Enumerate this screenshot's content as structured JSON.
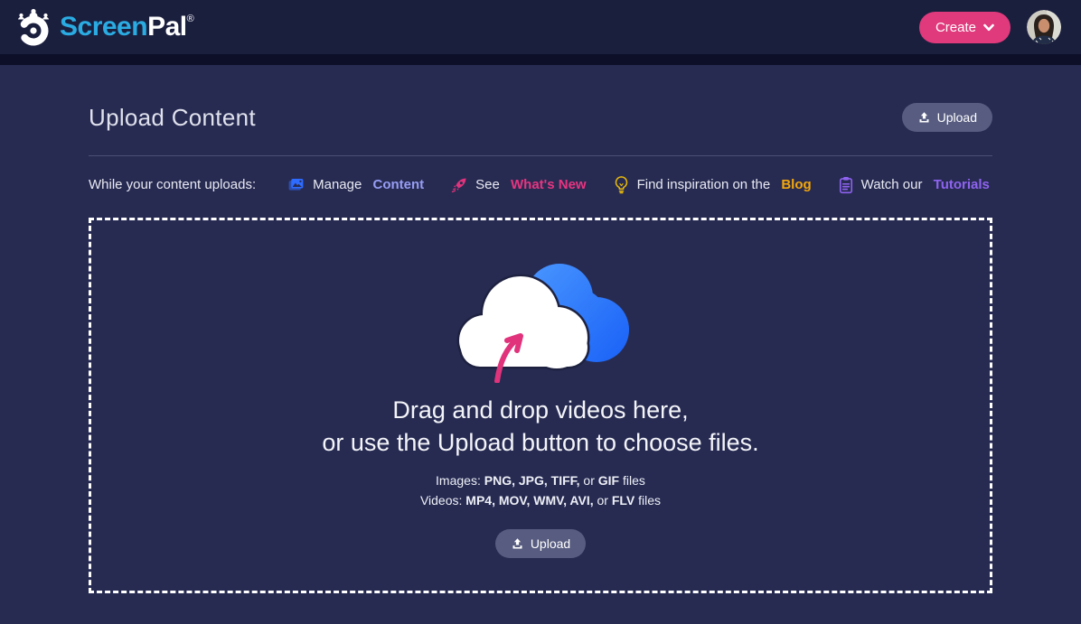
{
  "header": {
    "brand": {
      "screen": "Screen",
      "pal": "Pal",
      "registered": "®",
      "logo_icon": "screenpal-mascot-icon"
    },
    "create_button": {
      "label": "Create",
      "icon": "chevron-down-icon"
    },
    "avatar": {
      "icon": "user-avatar-photo"
    }
  },
  "page": {
    "title": "Upload Content",
    "upload_button_label": "Upload",
    "upload_button_icon": "upload-tray-icon"
  },
  "uploads_row": {
    "prefix": "While your content uploads:",
    "links": [
      {
        "icon": "photos-icon",
        "pre": "Manage ",
        "highlight": "Content"
      },
      {
        "icon": "rocket-icon",
        "pre": "See ",
        "highlight": "What's New"
      },
      {
        "icon": "lightbulb-icon",
        "pre": "Find inspiration on the ",
        "highlight": "Blog"
      },
      {
        "icon": "clipboard-icon",
        "pre": "Watch our ",
        "highlight": "Tutorials"
      }
    ]
  },
  "dropzone": {
    "illustration": "cloud-upload-illustration",
    "line1": "Drag and drop videos here,",
    "line2": "or use the Upload button to choose files.",
    "images_line": {
      "prefix": "Images: ",
      "bold1": "PNG, JPG, TIFF,",
      "mid": " or ",
      "bold2": "GIF",
      "suffix": " files"
    },
    "videos_line": {
      "prefix": "Videos: ",
      "bold1": "MP4, MOV, WMV, AVI,",
      "mid": " or ",
      "bold2": "FLV",
      "suffix": " files"
    },
    "upload_button_label": "Upload"
  },
  "colors": {
    "header_bg": "#1B1F3E",
    "page_bg": "#272B52",
    "create_pink": "#E0397C",
    "brand_blue": "#2AACE3",
    "pill_gray": "#575C80",
    "highlight_content": "#979DF3",
    "highlight_whats_new": "#E73580",
    "highlight_blog": "#F3A70B",
    "highlight_tutorials": "#8F63F0",
    "cloud_blue": "#2E7BFF",
    "arrow_pink": "#E0337C"
  }
}
